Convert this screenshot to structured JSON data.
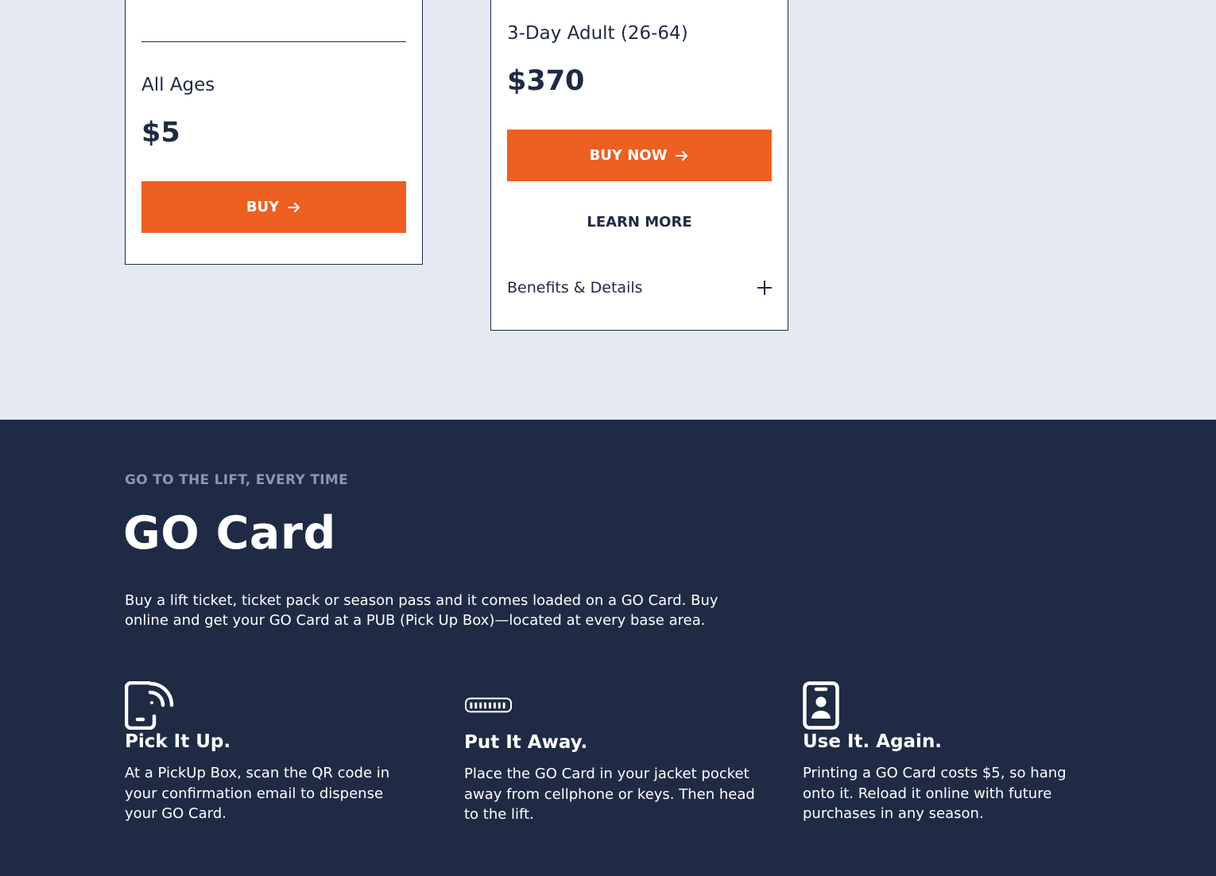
{
  "pricing": {
    "card1": {
      "ticket_name": "All Ages",
      "price": "$5",
      "buy_label": "BUY"
    },
    "card2": {
      "ticket_name": "3-Day Adult (26-64)",
      "price": "$370",
      "buy_label": "BUY NOW",
      "learn_more_label": "LEARN MORE",
      "accordion_label": "Benefits & Details"
    }
  },
  "go_card": {
    "eyebrow": "GO TO THE LIFT, EVERY TIME",
    "title": "GO Card",
    "intro": "Buy a lift ticket, ticket pack or season pass and it comes loaded on a GO Card. Buy online and get your GO Card at a PUB (Pick Up Box)—located at every base area.",
    "steps": [
      {
        "icon": "phone-scan-icon",
        "title": "Pick It Up.",
        "text": "At a PickUp Box, scan the QR code in your confirmation email to dispense your GO Card."
      },
      {
        "icon": "card-chip-icon",
        "title": "Put It Away.",
        "text": "Place the GO Card in your jacket pocket away from cellphone or keys. Then head to the lift."
      },
      {
        "icon": "id-badge-icon",
        "title": "Use It. Again.",
        "text": "Printing a GO Card costs $5, so hang onto it. Reload it online with future purchases in any season."
      }
    ]
  },
  "colors": {
    "page_background": "#e4e9f4",
    "navy": "#1f2a44",
    "accent_orange": "#ee5f22",
    "eyebrow_gray": "#8b97b3"
  }
}
